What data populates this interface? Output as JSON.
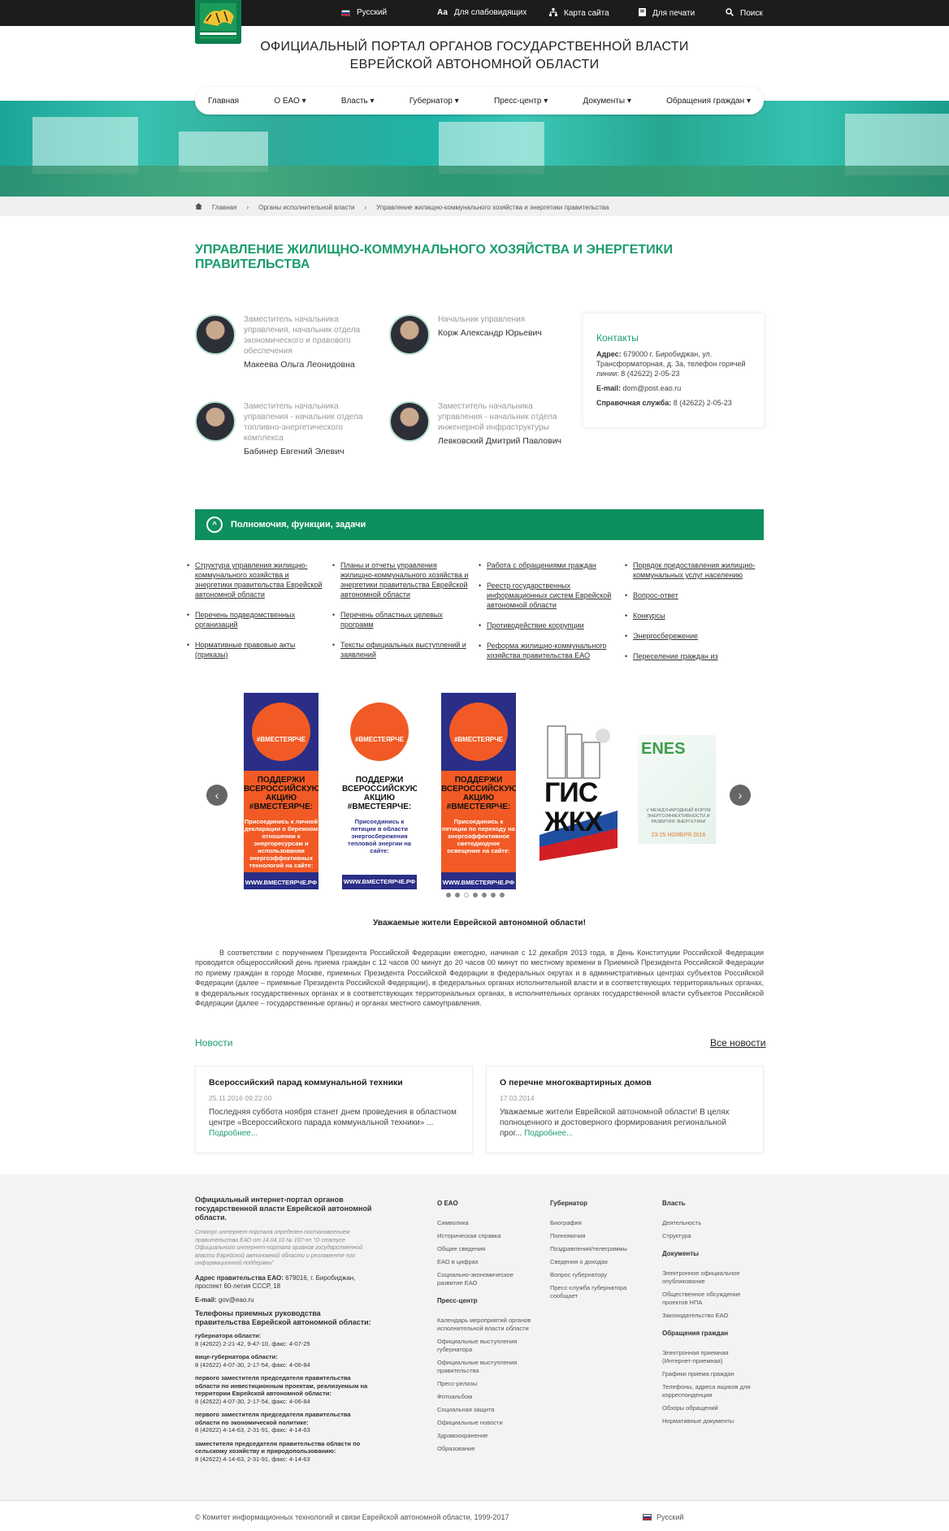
{
  "topbar": {
    "language": "Русский",
    "low_vision": "Для слабовидящих",
    "low_vision_icon": "Аа",
    "sitemap": "Карта сайта",
    "print": "Для печати",
    "search": "Поиск"
  },
  "site": {
    "title_line1": "ОФИЦИАЛЬНЫЙ ПОРТАЛ ОРГАНОВ ГОСУДАРСТВЕННОЙ ВЛАСТИ",
    "title_line2": "ЕВРЕЙСКОЙ АВТОНОМНОЙ ОБЛАСТИ"
  },
  "nav": [
    "Главная",
    "О ЕАО",
    "Власть",
    "Губернатор",
    "Пресс-центр",
    "Документы",
    "Обращения граждан"
  ],
  "breadcrumb": [
    "Главная",
    "Органы исполнительной власти",
    "Управление жилищно-коммунального хозяйства и энергетики правительства"
  ],
  "page_title": "УПРАВЛЕНИЕ ЖИЛИЩНО-КОММУНАЛЬНОГО ХОЗЯЙСТВА И ЭНЕРГЕТИКИ ПРАВИТЕЛЬСТВА",
  "staff": [
    {
      "role": "Заместитель начальника управления, начальник отдела экономического и правового обеспечения",
      "name": "Макеева Ольга Леонидовна"
    },
    {
      "role": "Начальник управления",
      "name": "Корж Александр Юрьевич"
    },
    {
      "role": "Заместитель начальника управления - начальник отдела топливно-энергетического комплекса",
      "name": "Бабинер Евгений Элевич"
    },
    {
      "role": "Заместитель начальника управления - начальник отдела инженерной инфраструктуры",
      "name": "Левковский Дмитрий Павлович"
    }
  ],
  "contacts": {
    "title": "Контакты",
    "address_label": "Адрес:",
    "address": "679000 г. Биробиджан, ул. Трансформаторная, д. 3а, телефон горячей линии: 8 (42622) 2-05-23",
    "email_label": "E-mail:",
    "email": "dom@post.eao.ru",
    "help_label": "Справочная служба:",
    "help": "8 (42622) 2-05-23"
  },
  "accordion": {
    "title": "Полномочия, функции, задачи",
    "icon": "^"
  },
  "links": [
    [
      "Структура управления жилищно-коммунального хозяйства и энергетики правительства Еврейской автономной области",
      "Перечень подведомственных организаций",
      "Нормативные правовые акты (приказы)"
    ],
    [
      "Планы и отчеты управления жилищно-коммунального хозяйства и энергетики правительства Еврейской автономной области",
      "Перечень областных целевых программ",
      "Тексты официальных выступлений и заявлений"
    ],
    [
      "Работа с обращениями граждан",
      "Реестр государственных информационных систем Еврейской автономной области",
      "Противодействие коррупции",
      "Реформа жилищно-коммунального хозяйства правительства ЕАО"
    ],
    [
      "Порядок предоставления жилищно-коммунальных услуг населению",
      "Вопрос-ответ",
      "Конкурсы",
      "Энергосбережение",
      "Переселение граждан из"
    ]
  ],
  "carousel": {
    "prev": "‹",
    "next": "›",
    "banners": [
      {
        "hashtag": "#ВМЕСТЕЯРЧЕ",
        "head": "ПОДДЕРЖИ ВСЕРОССИЙСКУЮ АКЦИЮ #ВМЕСТЕЯРЧЕ:",
        "body": "Присоединись к личной декларации о бережном отношении к энергоресурсам и использовании энергоэффективных технологий на сайте:",
        "url": "WWW.ВМЕСТЕЯРЧЕ.РФ"
      },
      {
        "hashtag": "#ВМЕСТЕЯРЧЕ",
        "head": "ПОДДЕРЖИ ВСЕРОССИЙСКУЮ АКЦИЮ #ВМЕСТЕЯРЧЕ:",
        "body": "Присоединись к петиции в области энергосбережения тепловой энергии на сайте:",
        "url": "WWW.ВМЕСТЕЯРЧЕ.РФ"
      },
      {
        "hashtag": "#ВМЕСТЕЯРЧЕ",
        "head": "ПОДДЕРЖИ ВСЕРОССИЙСКУЮ АКЦИЮ #ВМЕСТЕЯРЧЕ:",
        "body": "Присоединись к петиции по переходу на энергоэффективное светодиодное освещение на сайте:",
        "url": "WWW.ВМЕСТЕЯРЧЕ.РФ"
      }
    ],
    "gis": "ГИС ЖКХ",
    "enes": {
      "logo": "ENES",
      "sub": "V МЕЖДУНАРОДНЫЙ ФОРУМ ЭНЕРГОЭФФЕКТИВНОСТИ И РАЗВИТИЯ ЭНЕРГЕТИКИ",
      "date": "23-25 НОЯБРЯ 2016"
    },
    "dot_count": 7,
    "active_dot": 3
  },
  "notice": {
    "title": "Уважаемые жители Еврейской автономной области!",
    "text": "В соответствии с поручением Президента Российской Федерации ежегодно, начиная с 12 декабря 2013 года, в День Конституции Российской Федерации проводится общероссийский день приема граждан с 12 часов 00 минут до 20 часов 00 минут по местному времени в Приемной Президента Российской Федерации по приему граждан в городе Москве, приемных Президента Российской Федерации в федеральных округах и в административных центрах субъектов Российской Федерации (далее – приемные Президента Российской Федерации), в федеральных органах исполнительной власти и в соответствующих территориальных органах, в федеральных государственных органах и в соответствующих территориальных органах, в исполнительных органах государственной власти субъектов Российской Федерации (далее – государственные органы) и органах местного самоуправления."
  },
  "news": {
    "title": "Новости",
    "all": "Все новости",
    "items": [
      {
        "title": "Всероссийский парад коммунальной техники",
        "date": "25.11.2016 09:22:00",
        "text": "Последняя суббота ноября станет днем проведения в областном центре «Всероссийского парада коммунальной техники» ...",
        "more": "Подробнее..."
      },
      {
        "title": "О перечне многоквартирных домов",
        "date": "17.03.2014",
        "text": "Уважаемые жители Еврейской автономной области! В целях полноценного и достоверного формирования региональной прог...",
        "more": "Подробнее..."
      }
    ]
  },
  "footer": {
    "portal": "Официальный интернет-портал органов государственной власти Еврейской автономной области.",
    "status": "Статус интернет-портала определен постановлением правительства ЕАО от 14.04.10 № 107-пп \"О статусе Официального интернет-портала органов государственной власти Еврейской автономной области и регламенте его информационной поддержки\"",
    "address_label": "Адрес правительства ЕАО:",
    "address": "679016, г. Биробиджан, проспект 60-летия СССР, 18",
    "email_label": "E-mail:",
    "email": "gov@eao.ru",
    "phones_title": "Телефоны приемных руководства правительства Еврейской автономной области:",
    "phones": [
      {
        "who": "губернатора области:",
        "num": "8 (42622) 2-21-42, 9-47-10, факс: 4-07-25"
      },
      {
        "who": "вице-губернатора области:",
        "num": "8 (42622) 4-07-30, 2-17-54, факс: 4-06-84"
      },
      {
        "who": "первого заместителя председателя правительства области по инвестиционным проектам, реализуемым на территории Еврейской автономной области:",
        "num": "8 (42622) 4-07-30, 2-17-54, факс: 4-06-84"
      },
      {
        "who": "первого заместителя председателя правительства области по экономической политике:",
        "num": "8 (42622) 4-14-63, 2-31-91, факс: 4-14-63"
      },
      {
        "who": "заместителя председателя правительства области по сельскому хозяйству и природопользованию:",
        "num": "8 (42622) 4-14-63, 2-31-91, факс: 4-14-63"
      }
    ],
    "col_eao": {
      "title": "О ЕАО",
      "items": [
        "Символика",
        "Историческая справка",
        "Общие сведения",
        "ЕАО в цифрах",
        "Социально-экономическое развитие ЕАО"
      ]
    },
    "col_press": {
      "title": "Пресс-центр",
      "items": [
        "Календарь мероприятий органов исполнительной власти области",
        "Официальные выступления губернатора",
        "Официальные выступления правительства",
        "Пресс-релизы",
        "Фотоальбом",
        "Социальная защита",
        "Официальные новости",
        "Здравоохранение",
        "Образование"
      ]
    },
    "col_gov": {
      "title": "Губернатор",
      "items": [
        "Биография",
        "Полномочия",
        "Поздравления/телеграммы",
        "Сведения о доходах",
        "Вопрос губернатору",
        "Пресс-служба губернатора сообщает"
      ]
    },
    "col_power": {
      "title": "Власть",
      "items": [
        "Деятельность",
        "Структура"
      ]
    },
    "col_docs": {
      "title": "Документы",
      "items": [
        "Электронное официальное опубликование",
        "Общественное обсуждение проектов НПА",
        "Законодательство ЕАО"
      ]
    },
    "col_appeals": {
      "title": "Обращения граждан",
      "items": [
        "Электронная приемная (Интернет-приемная)",
        "Графики приема граждан",
        "Телефоны, адреса ящиков для корреспонденции",
        "Обзоры обращений",
        "Нормативные документы"
      ]
    }
  },
  "copyright": "© Комитет информационных технологий и связи Еврейской автономной области, 1999-2017",
  "footer_language": "Русский",
  "colors": {
    "brand_green": "#0e8f5e",
    "accent_green": "#1a9d6a",
    "topbar": "#1c1c1c"
  }
}
